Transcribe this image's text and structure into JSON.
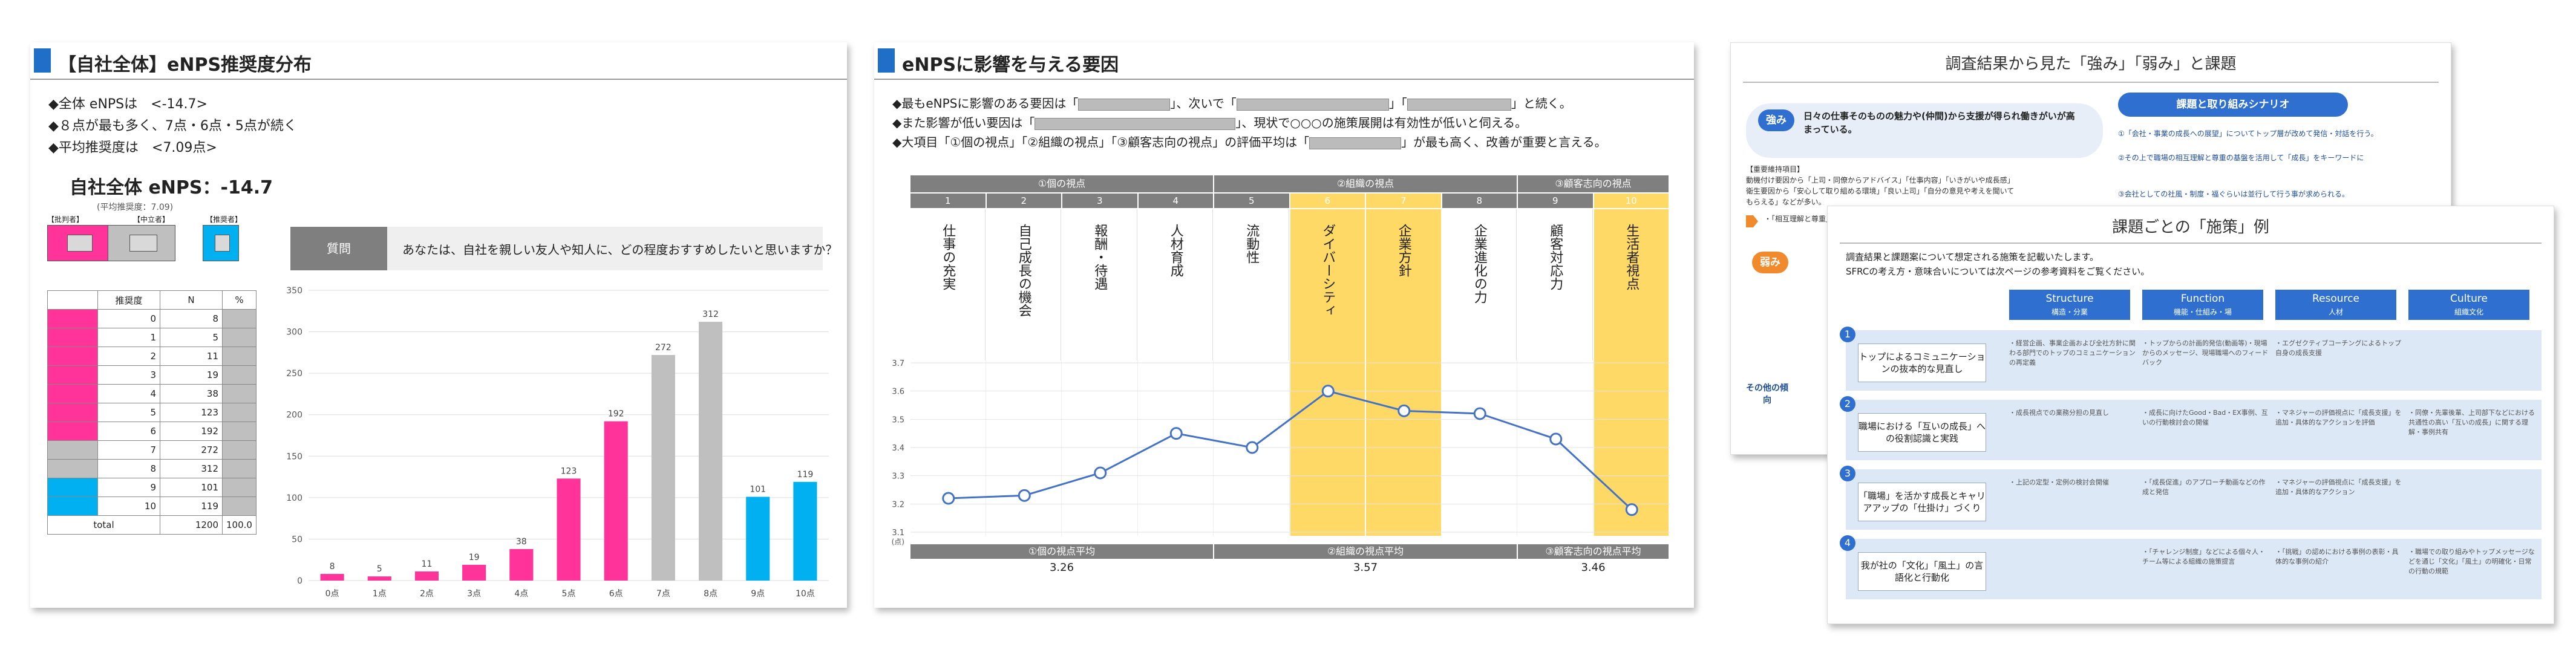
{
  "colors": {
    "pink": "#ff3399",
    "gray": "#bfbfbf",
    "blue": "#00b0f0",
    "accent": "#1f6fc8",
    "highlight": "#ffd966",
    "line": "#4472c4"
  },
  "slide1": {
    "title": "【自社全体】eNPS推奨度分布",
    "bullets": [
      "◆全体 eNPSは　<-14.7>",
      "◆８点が最も多く、7点・6点・5点が続く",
      "◆平均推奨度は　<7.09点>"
    ],
    "big_title": "自社全体 eNPS：-14.7",
    "avg_note": "(平均推奨度：7.09)",
    "legend": [
      "【批判者】",
      "【中立者】",
      "【推奨者】"
    ],
    "question_label": "質問",
    "question_text": "あなたは、自社を親しい友人や知人に、どの程度おすすめしたいと思いますか？",
    "table_headers": [
      "推奨度",
      "N",
      "%"
    ],
    "table_rows": [
      [
        "0",
        "8"
      ],
      [
        "1",
        "5"
      ],
      [
        "2",
        "11"
      ],
      [
        "3",
        "19"
      ],
      [
        "4",
        "38"
      ],
      [
        "5",
        "123"
      ],
      [
        "6",
        "192"
      ],
      [
        "7",
        "272"
      ],
      [
        "8",
        "312"
      ],
      [
        "9",
        "101"
      ],
      [
        "10",
        "119"
      ]
    ],
    "total_label": "total",
    "total_n": "1200",
    "total_pct": "100.0"
  },
  "chart_data": {
    "type": "bar",
    "categories": [
      "0点",
      "1点",
      "2点",
      "3点",
      "4点",
      "5点",
      "6点",
      "7点",
      "8点",
      "9点",
      "10点"
    ],
    "values": [
      8,
      5,
      11,
      19,
      38,
      123,
      192,
      272,
      312,
      101,
      119
    ],
    "groups": [
      "pink",
      "pink",
      "pink",
      "pink",
      "pink",
      "pink",
      "pink",
      "gray",
      "gray",
      "blue",
      "blue"
    ],
    "ylim": [
      0,
      350
    ],
    "yticks": [
      "0",
      "50",
      "100",
      "150",
      "200",
      "250",
      "300",
      "350"
    ],
    "grid": true
  },
  "slide2": {
    "title": "eNPSに影響を与える要因",
    "bullets": [
      "◆最もeNPSに影響のある要因は「",
      "◆また影響が低い要因は「",
      "◆大項目「①個の視点」「②組織の視点」「③顧客志向の視点」の評価平均は「"
    ],
    "bullet_tails": [
      "」、次いで「",
      "」、現状で○○○の施策展開は有効性が低いと伺える。",
      "」が最も高く、改善が重要と言える。"
    ],
    "bullet_mid": [
      "」「",
      "」と続く。"
    ],
    "groups": [
      "①個の視点",
      "②組織の視点",
      "③顧客志向の視点"
    ],
    "numbers": [
      "1",
      "2",
      "3",
      "4",
      "5",
      "6",
      "7",
      "8",
      "9",
      "10"
    ],
    "factors": [
      "仕事の充実",
      "自己成長の機会",
      "報酬・待遇",
      "人材育成",
      "流動性",
      "ダイバーシティ",
      "企業方針",
      "企業進化の力",
      "顧客対応力",
      "生活者視点"
    ],
    "highlight": [
      false,
      false,
      false,
      false,
      false,
      true,
      true,
      false,
      false,
      true
    ],
    "line_values": [
      3.22,
      3.23,
      3.31,
      3.45,
      3.4,
      3.6,
      3.53,
      3.52,
      3.43,
      3.18
    ],
    "yticks": [
      "3.7",
      "3.6",
      "3.5",
      "3.4",
      "3.3",
      "3.2",
      "3.1"
    ],
    "y_unit": "(点)",
    "avg_labels": [
      "①個の視点平均",
      "②組織の視点平均",
      "③顧客志向の視点平均"
    ],
    "avg_values": [
      "3.26",
      "3.57",
      "3.46"
    ]
  },
  "slide3": {
    "title": "調査結果から見た「強み」「弱み」と課題",
    "strength_label": "強み",
    "strength_text": "日々の仕事そのものの魅力や(仲間)から支援が得られ働きがいが高まっている。",
    "weak_label": "弱み",
    "pill": "課題と取り組みシナリオ",
    "notes": [
      "【重要維持項目】",
      "動機付け要因から「上司・同僚からアドバイス」「仕事内容」「いきがいや成長感」",
      "衛生要因から「安心して取り組める環境」「良い上司」「自分の意見や考えを聞いて",
      "もらえる」などが多い。",
      "・「相互理解と尊重」が職場での働きがいを支えている。"
    ],
    "right": [
      "①「会社・事業の成長への展望」についてトップ層が改めて発信・対話を行う。",
      "②その上で職場の相互理解と尊重の基盤を活用して「成長」をキーワードに",
      "③会社としての社風・制度・福ぐらいは並行して行う事が求められる。"
    ],
    "other_label": "その他の傾向"
  },
  "slide4": {
    "title": "課題ごとの「施策」例",
    "intro": [
      "調査結果と課題案について想定される施策を記載いたします。",
      "SFRCの考え方・意味合いについては次ページの参考資料をご覧ください。"
    ],
    "columns": [
      [
        "Structure",
        "構造・分業"
      ],
      [
        "Function",
        "機能・仕組み・場"
      ],
      [
        "Resource",
        "人材"
      ],
      [
        "Culture",
        "組織文化"
      ]
    ],
    "themes": [
      "トップによるコミュニケーションの抜本的な見直し",
      "職場における「互いの成長」への役割認識と実践",
      "「職場」を活かす成長とキャリアアップの「仕掛け」づくり",
      "我が社の「文化」「風土」の言語化と行動化"
    ],
    "cells": [
      [
        "・経営企画、事業企画および全社方針に関わる部門でのトップのコミュニケーションの再定義",
        "・トップからの計画的発信(動画等)・現場からのメッセージ、現場職場へのフィードバック",
        "・エグゼクティブコーチングによるトップ自身の成長支援",
        ""
      ],
      [
        "・成長視点での業務分担の見直し",
        "・成長に向けたGood・Bad・EX事例、互いの行動検討会の開催",
        "・マネジャーの評価視点に「成長支援」を追加・具体的なアクションを評価",
        "・同僚・先輩後輩、上司部下などにおける共通性の高い「互いの成長」に関する理解・事例共有"
      ],
      [
        "・上記の定型・定例の検討会開催",
        "・「成長促進」のアプローチ動画などの作成と発信",
        "・マネジャーの評価視点に「成長支援」を追加・具体的なアクション",
        ""
      ],
      [
        "",
        "・「チャレンジ制度」などによる個々人・チーム等による組織の施策提言",
        "・「挑戦」の認めにおける事例の表彰・具体的な事例の紹介",
        "・職場での取り組みやトップメッセージなどを通じ「文化」「風土」の明確化・日常の行動の規範"
      ]
    ]
  }
}
